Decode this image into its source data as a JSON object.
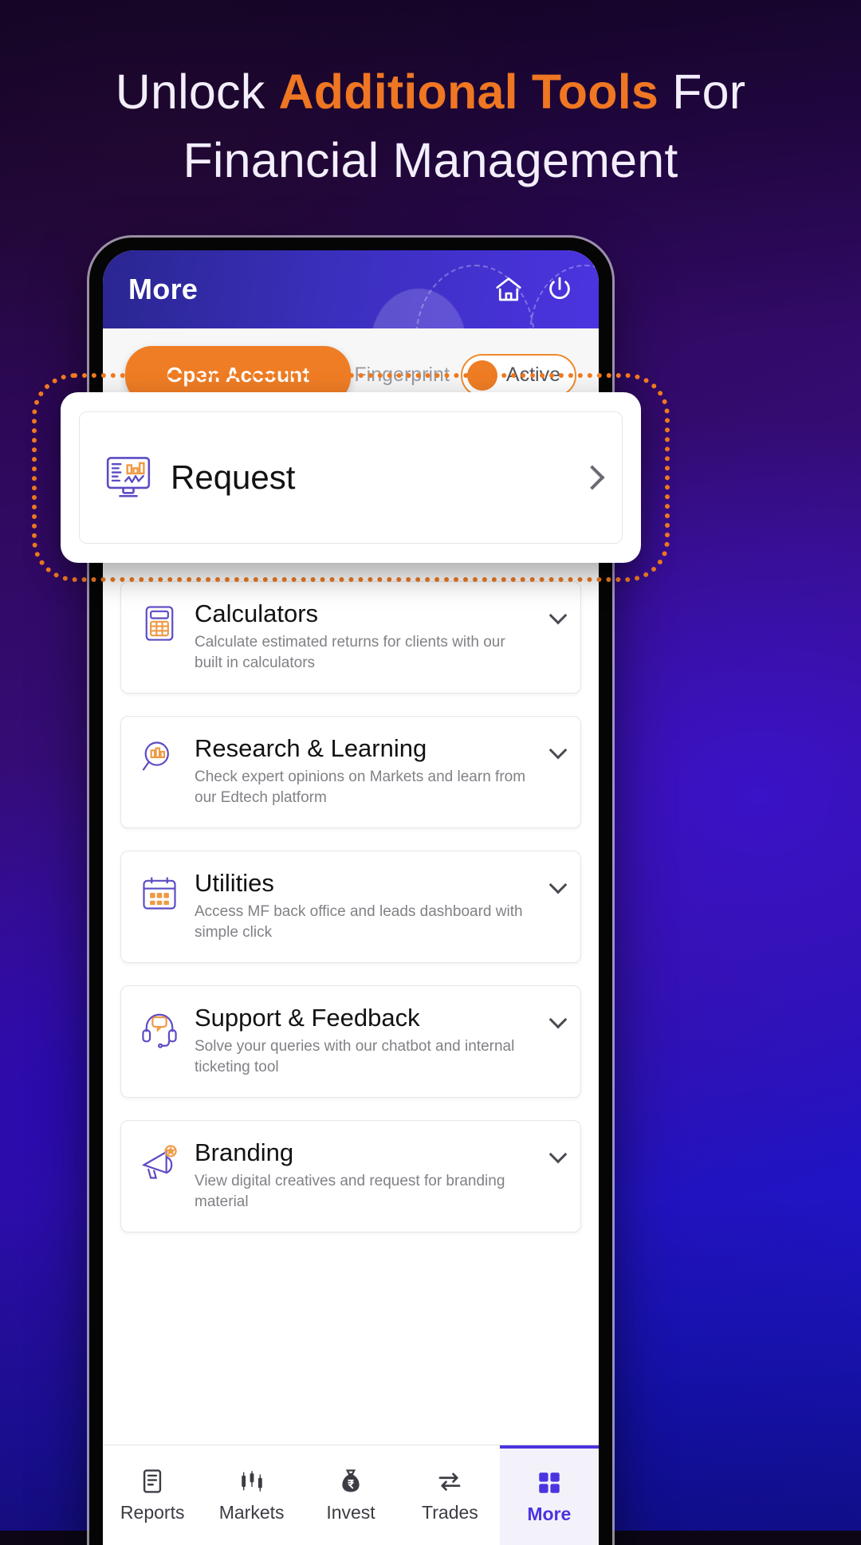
{
  "promo": {
    "headline_line1_pre": "Unlock ",
    "headline_highlight": "Additional Tools",
    "headline_line1_post": " For",
    "headline_line2": "Financial Management",
    "accent_color": "#ef7622",
    "text_color": "#f3eefb"
  },
  "app": {
    "header": {
      "title": "More",
      "home_icon": "home-icon",
      "power_icon": "power-icon"
    },
    "actions": {
      "open_account_label": "Open Account",
      "fingerprint_label": "Fingerprint",
      "fingerprint_state": "Active",
      "toggle_color": "#ef7d25"
    },
    "callout": {
      "title": "Request",
      "icon": "monitor-chart-icon",
      "chevron": "chevron-right-icon",
      "ring_color": "#f07a1f"
    },
    "cards": [
      {
        "title": "Calculators",
        "desc": "Calculate estimated returns for clients with our built in calculators",
        "icon": "calculator-icon"
      },
      {
        "title": "Research & Learning",
        "desc": "Check expert opinions on Markets and learn from our Edtech platform",
        "icon": "magnifier-chart-icon"
      },
      {
        "title": "Utilities",
        "desc": "Access MF back office and leads dashboard with simple click",
        "icon": "calendar-icon"
      },
      {
        "title": "Support & Feedback",
        "desc": "Solve your queries with our chatbot and internal ticketing tool",
        "icon": "headset-icon"
      },
      {
        "title": "Branding",
        "desc": "View digital creatives and request for branding material",
        "icon": "megaphone-icon"
      }
    ],
    "bottom_nav": [
      {
        "label": "Reports",
        "icon": "report-icon",
        "active": false
      },
      {
        "label": "Markets",
        "icon": "candlestick-icon",
        "active": false
      },
      {
        "label": "Invest",
        "icon": "money-bag-rupee-icon",
        "active": false
      },
      {
        "label": "Trades",
        "icon": "exchange-arrows-icon",
        "active": false
      },
      {
        "label": "More",
        "icon": "grid-icon",
        "active": true
      }
    ]
  }
}
